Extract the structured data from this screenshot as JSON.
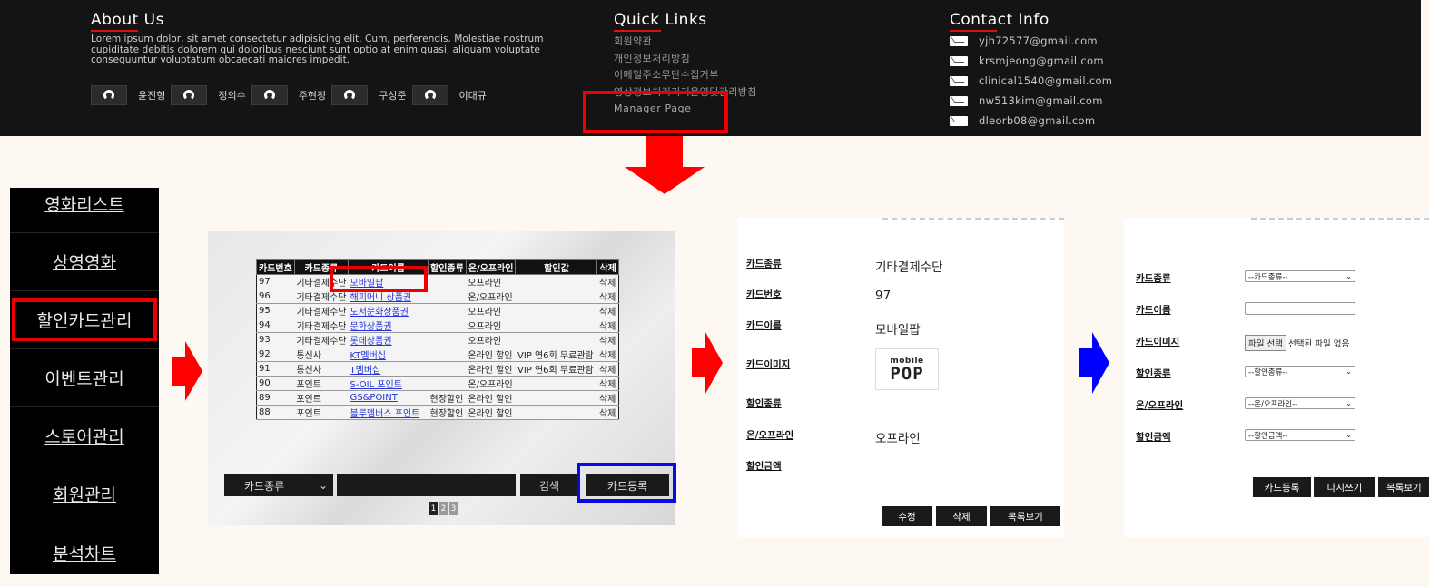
{
  "footer": {
    "about": {
      "title": "About Us",
      "text": "Lorem ipsum dolor, sit amet consectetur adipisicing elit. Cum, perferendis. Molestiae nostrum cupiditate debitis dolorem qui doloribus nesciunt sunt optio at enim quasi, aliquam voluptate consequuntur voluptatum obcaecati maiores impedit.",
      "members": [
        "윤진형",
        "정의수",
        "주현정",
        "구성준",
        "이대규"
      ]
    },
    "quick_links": {
      "title": "Quick Links",
      "items": [
        "회원약관",
        "개인정보처리방침",
        "이메일주소무단수집거부",
        "영상정보처리기기운영및관리방침"
      ],
      "manager_page": "Manager Page"
    },
    "contact": {
      "title": "Contact Info",
      "emails": [
        "yjh72577@gmail.com",
        "krsmjeong@gmail.com",
        "clinical1540@gmail.com",
        "nw513kim@gmail.com",
        "dleorb08@gmail.com"
      ]
    }
  },
  "sidebar": {
    "items": [
      "영화리스트",
      "상영영화",
      "할인카드관리",
      "이벤트관리",
      "스토어관리",
      "회원관리",
      "분석차트"
    ]
  },
  "card_list": {
    "headers": [
      "카드번호",
      "카드종류",
      "카드이름",
      "할인종류",
      "온/오프라인",
      "할인값",
      "삭제"
    ],
    "rows": [
      [
        "97",
        "기타결제수단",
        "모바일팝",
        "",
        "오프라인",
        "",
        "삭제"
      ],
      [
        "96",
        "기타결제수단",
        "해피머니 상품권",
        "",
        "온/오프라인",
        "",
        "삭제"
      ],
      [
        "95",
        "기타결제수단",
        "도서문화상품권",
        "",
        "오프라인",
        "",
        "삭제"
      ],
      [
        "94",
        "기타결제수단",
        "문화상품권",
        "",
        "오프라인",
        "",
        "삭제"
      ],
      [
        "93",
        "기타결제수단",
        "롯데상품권",
        "",
        "오프라인",
        "",
        "삭제"
      ],
      [
        "92",
        "통신사",
        "KT멤버십",
        "",
        "온라인 할인",
        "VIP 연6회 무료관람",
        "삭제"
      ],
      [
        "91",
        "통신사",
        "T멤버십",
        "",
        "온라인 할인",
        "VIP 연6회 무료관람",
        "삭제"
      ],
      [
        "90",
        "포인트",
        "S-OIL 포인트",
        "",
        "온/오프라인",
        "",
        "삭제"
      ],
      [
        "89",
        "포인트",
        "GS&POINT",
        "현장할인",
        "온라인 할인",
        "",
        "삭제"
      ],
      [
        "88",
        "포인트",
        "블루멤버스 포인트",
        "현장할인",
        "온라인 할인",
        "",
        "삭제"
      ]
    ],
    "search_select": "카드종류",
    "search_button": "검색",
    "register_button": "카드등록",
    "pages": [
      "1",
      "2",
      "3"
    ]
  },
  "card_detail": {
    "labels": {
      "type": "카드종류",
      "number": "카드번호",
      "name": "카드이름",
      "image": "카드이미지",
      "discount_type": "할인종류",
      "online": "온/오프라인",
      "amount": "할인금액"
    },
    "values": {
      "type": "기타결제수단",
      "number": "97",
      "name": "모바일팝",
      "online": "오프라인"
    },
    "logo": {
      "top": "mobile",
      "bottom": "POP"
    },
    "buttons": {
      "edit": "수정",
      "delete": "삭제",
      "list": "목록보기"
    }
  },
  "card_register": {
    "labels": {
      "type": "카드종류",
      "name": "카드이름",
      "image": "카드이미지",
      "discount_type": "할인종류",
      "online": "온/오프라인",
      "amount": "할인금액"
    },
    "selects": {
      "type": "--카드종류--",
      "discount_type": "--할인종류--",
      "online": "--온/오프라인--",
      "amount": "--할인금액--"
    },
    "file": {
      "button": "파일 선택",
      "status": "선택된 파일 없음"
    },
    "buttons": {
      "register": "카드등록",
      "reset": "다시쓰기",
      "list": "목록보기"
    }
  },
  "colors": {
    "highlight_red": "#e00000",
    "highlight_blue": "#0a0ae6",
    "arrow_red": "#ff0000",
    "arrow_blue": "#0000ff",
    "link_blue": "#2233dd"
  }
}
